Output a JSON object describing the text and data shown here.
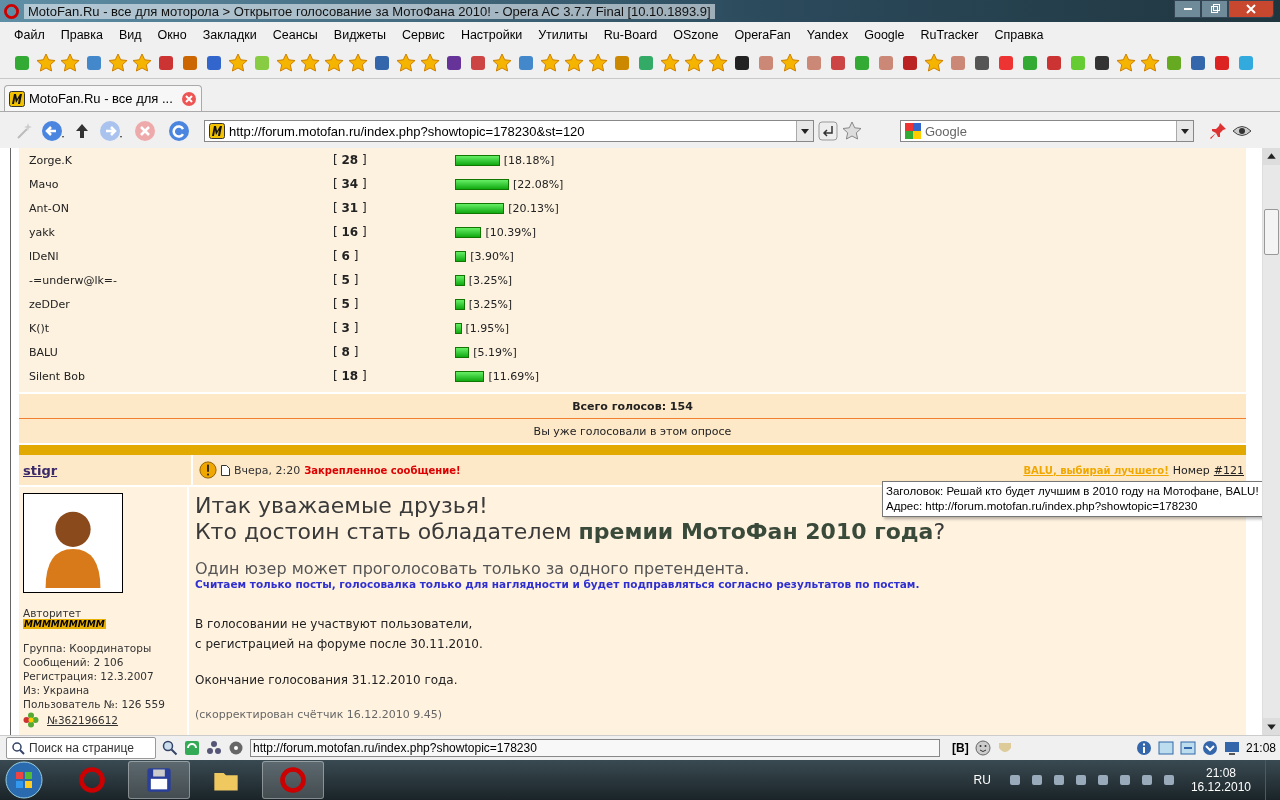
{
  "window": {
    "title": "MotoFan.Ru - все для моторола > Открытое голосование за МотоФана 2010! - Opera AC 3.7.7 Final [10.10.1893.9]"
  },
  "menu": [
    "Файл",
    "Правка",
    "Вид",
    "Окно",
    "Закладки",
    "Сеансы",
    "Виджеты",
    "Сервис",
    "Настройки",
    "Утилиты",
    "Ru-Board",
    "OSzone",
    "OperaFan",
    "Yandex",
    "Google",
    "RuTracker",
    "Справка"
  ],
  "tabs": [
    {
      "label": "MotoFan.Ru - все для ...",
      "selected": true
    }
  ],
  "address": {
    "value": "http://forum.motofan.ru/index.php?showtopic=178230&st=120"
  },
  "search": {
    "placeholder": "Google"
  },
  "poll": {
    "rows": [
      {
        "name": "Zorge.K",
        "votes": "[ **28** ]",
        "percent": "[18.18%]"
      },
      {
        "name": "Мачо",
        "votes": "[ **34** ]",
        "percent": "[22.08%]"
      },
      {
        "name": "Ant-ON",
        "votes": "[ **31** ]",
        "percent": "[20.13%]"
      },
      {
        "name": "yakk",
        "votes": "[ **16** ]",
        "percent": "[10.39%]"
      },
      {
        "name": "lDeNl",
        "votes": "[ **6** ]",
        "percent": "[3.90%]"
      },
      {
        "name": "-=underw@lk=-",
        "votes": "[ **5** ]",
        "percent": "[3.25%]"
      },
      {
        "name": "zeDDer",
        "votes": "[ **5** ]",
        "percent": "[3.25%]"
      },
      {
        "name": "K()t",
        "votes": "[ **3** ]",
        "percent": "[1.95%]"
      },
      {
        "name": "BALU",
        "votes": "[ **8** ]",
        "percent": "[5.19%]"
      },
      {
        "name": "Silent Bob",
        "votes": "[ **18** ]",
        "percent": "[11.69%]"
      }
    ],
    "total": "Всего голосов: 154",
    "note": "Вы уже голосовали в этом опросе"
  },
  "post": {
    "author": "stigr",
    "date": "Вчера, 2:20",
    "pinned": "Закрепленное сообщение!",
    "link": "BALU, выбирай лучшего!",
    "number_label": "Номер",
    "number": "#121",
    "heading": [
      "Итак уважаемые друзья!",
      "Кто достоин стать обладателем **премии МотоФан 2010 года**?"
    ],
    "lead": "Один юзер может проголосовать только за одного претендента.",
    "notice": "Считаем только посты, голосовалка только для наглядности и будет подправляться согласно результатов по постам.",
    "paragraphs": [
      [
        "В голосовании не участвуют пользователи,",
        "с регистрацией на форуме после 30.11.2010."
      ],
      [
        "Окончание голосования 31.12.2010 года."
      ]
    ],
    "edited": "(скорректирован счётчик 16.12.2010 9.45)",
    "user": {
      "rank": "Авторитет",
      "rank_badge": "MMMMMMMMM",
      "info": [
        "Группа: Координаторы",
        "Сообщений: 2 106",
        "Регистрация: 12.3.2007",
        "Из: Украина",
        "Пользователь №: 126 559"
      ],
      "icq": "№362196612"
    }
  },
  "tooltip": {
    "lines": [
      "Заголовок: Решай кто будет лучшим в 2010 году на Мотофане, BALU!",
      "Адрес: http://forum.motofan.ru/index.php?showtopic=178230"
    ]
  },
  "status_bar": {
    "find_placeholder": "Поиск на странице",
    "url": "http://forum.motofan.ru/index.php?showtopic=178230",
    "bold_button": "[B]",
    "time": "21:08"
  },
  "taskbar": {
    "language": "RU",
    "time": "21:08",
    "date": "16.12.2010"
  }
}
